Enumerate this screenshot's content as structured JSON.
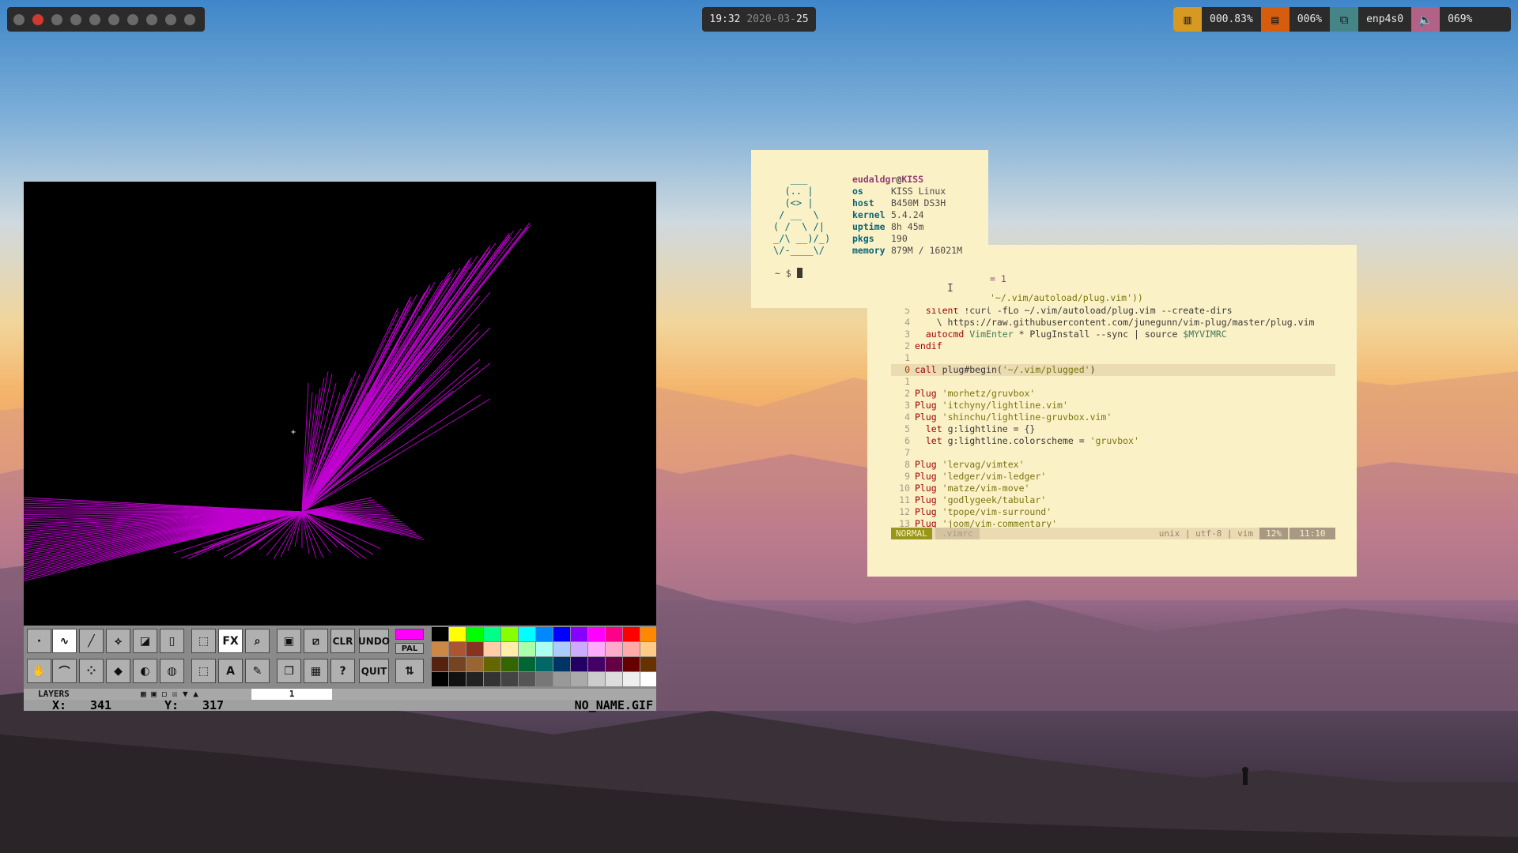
{
  "topbar": {
    "workspaces_count": 10,
    "active_workspace": 1,
    "clock": {
      "time": "19:32",
      "date_prefix": "2020-03-",
      "date_day": "25"
    },
    "status": [
      {
        "icon": "cpu-icon",
        "value": "000.83%",
        "color": "#d79921"
      },
      {
        "icon": "memory-icon",
        "value": "006%",
        "color": "#d65d0e"
      },
      {
        "icon": "network-icon",
        "value": "enp4s0",
        "color": "#458588"
      },
      {
        "icon": "volume-icon",
        "value": "069%",
        "color": "#b16286"
      }
    ]
  },
  "paint": {
    "layers_label": "LAYERS",
    "layer_value": "1",
    "coord_x_label": "X:",
    "coord_x": "341",
    "coord_y_label": "Y:",
    "coord_y": "317",
    "filename": "NO_NAME.GIF",
    "tools": {
      "fx": "FX",
      "clr": "CLR",
      "undo": "UNDO",
      "quit": "QUIT",
      "pal": "PAL",
      "help": "?",
      "text": "A"
    },
    "fore_color": "#ff00ff"
  },
  "neofetch": {
    "ascii_art": "   ___\n  (.. |\n  (<> |\n / __  \\\n( /  \\ /|\n_/\\ __)/_)\n\\/-____\\/",
    "user": "eudaldgr",
    "at": "@",
    "host_name": "KISS",
    "rows": [
      {
        "key": "os",
        "value": "KISS Linux"
      },
      {
        "key": "host",
        "value": "B450M DS3H"
      },
      {
        "key": "kernel",
        "value": "5.4.24"
      },
      {
        "key": "uptime",
        "value": "8h 45m"
      },
      {
        "key": "pkgs",
        "value": "190"
      },
      {
        "key": "memory",
        "value": "879M / 16021M"
      }
    ],
    "prompt": "~ $"
  },
  "vim": {
    "partial_line": "= 1",
    "partial_line2": "'~/.vim/autoload/plug.vim'))",
    "lines": [
      {
        "n": "5",
        "a": "  silent !curl -fLo ~/.vim/autoload/plug.vim --create-dirs",
        "cls": ""
      },
      {
        "n": "4",
        "a": "    \\ https://raw.githubusercontent.com/junegunn/vim-plug/master/plug.vim",
        "cls": ""
      },
      {
        "n": "3",
        "a": "  autocmd VimEnter * PlugInstall --sync | source $MYVIMRC",
        "cls": ""
      },
      {
        "n": "2",
        "a": "endif",
        "cls": ""
      },
      {
        "n": "1",
        "a": "",
        "cls": ""
      },
      {
        "n": "0",
        "a": "call plug#begin('~/.vim/plugged')",
        "cls": "cur"
      },
      {
        "n": "1",
        "a": "",
        "cls": ""
      },
      {
        "n": "2",
        "a": "Plug 'morhetz/gruvbox'",
        "cls": ""
      },
      {
        "n": "3",
        "a": "Plug 'itchyny/lightline.vim'",
        "cls": ""
      },
      {
        "n": "4",
        "a": "Plug 'shinchu/lightline-gruvbox.vim'",
        "cls": ""
      },
      {
        "n": "5",
        "a": "  let g:lightline = {}",
        "cls": ""
      },
      {
        "n": "6",
        "a": "  let g:lightline.colorscheme = 'gruvbox'",
        "cls": ""
      },
      {
        "n": "7",
        "a": "",
        "cls": ""
      },
      {
        "n": "8",
        "a": "Plug 'lervag/vimtex'",
        "cls": ""
      },
      {
        "n": "9",
        "a": "Plug 'ledger/vim-ledger'",
        "cls": ""
      },
      {
        "n": "10",
        "a": "Plug 'matze/vim-move'",
        "cls": ""
      },
      {
        "n": "11",
        "a": "Plug 'godlygeek/tabular'",
        "cls": ""
      },
      {
        "n": "12",
        "a": "Plug 'tpope/vim-surround'",
        "cls": ""
      },
      {
        "n": "13",
        "a": "Plug 'joom/vim-commentary'",
        "cls": ""
      }
    ],
    "status": {
      "mode": "NORMAL",
      "file": ".vimrc",
      "info": "unix | utf-8 | vim",
      "percent": "12%",
      "position": "11:10"
    }
  }
}
